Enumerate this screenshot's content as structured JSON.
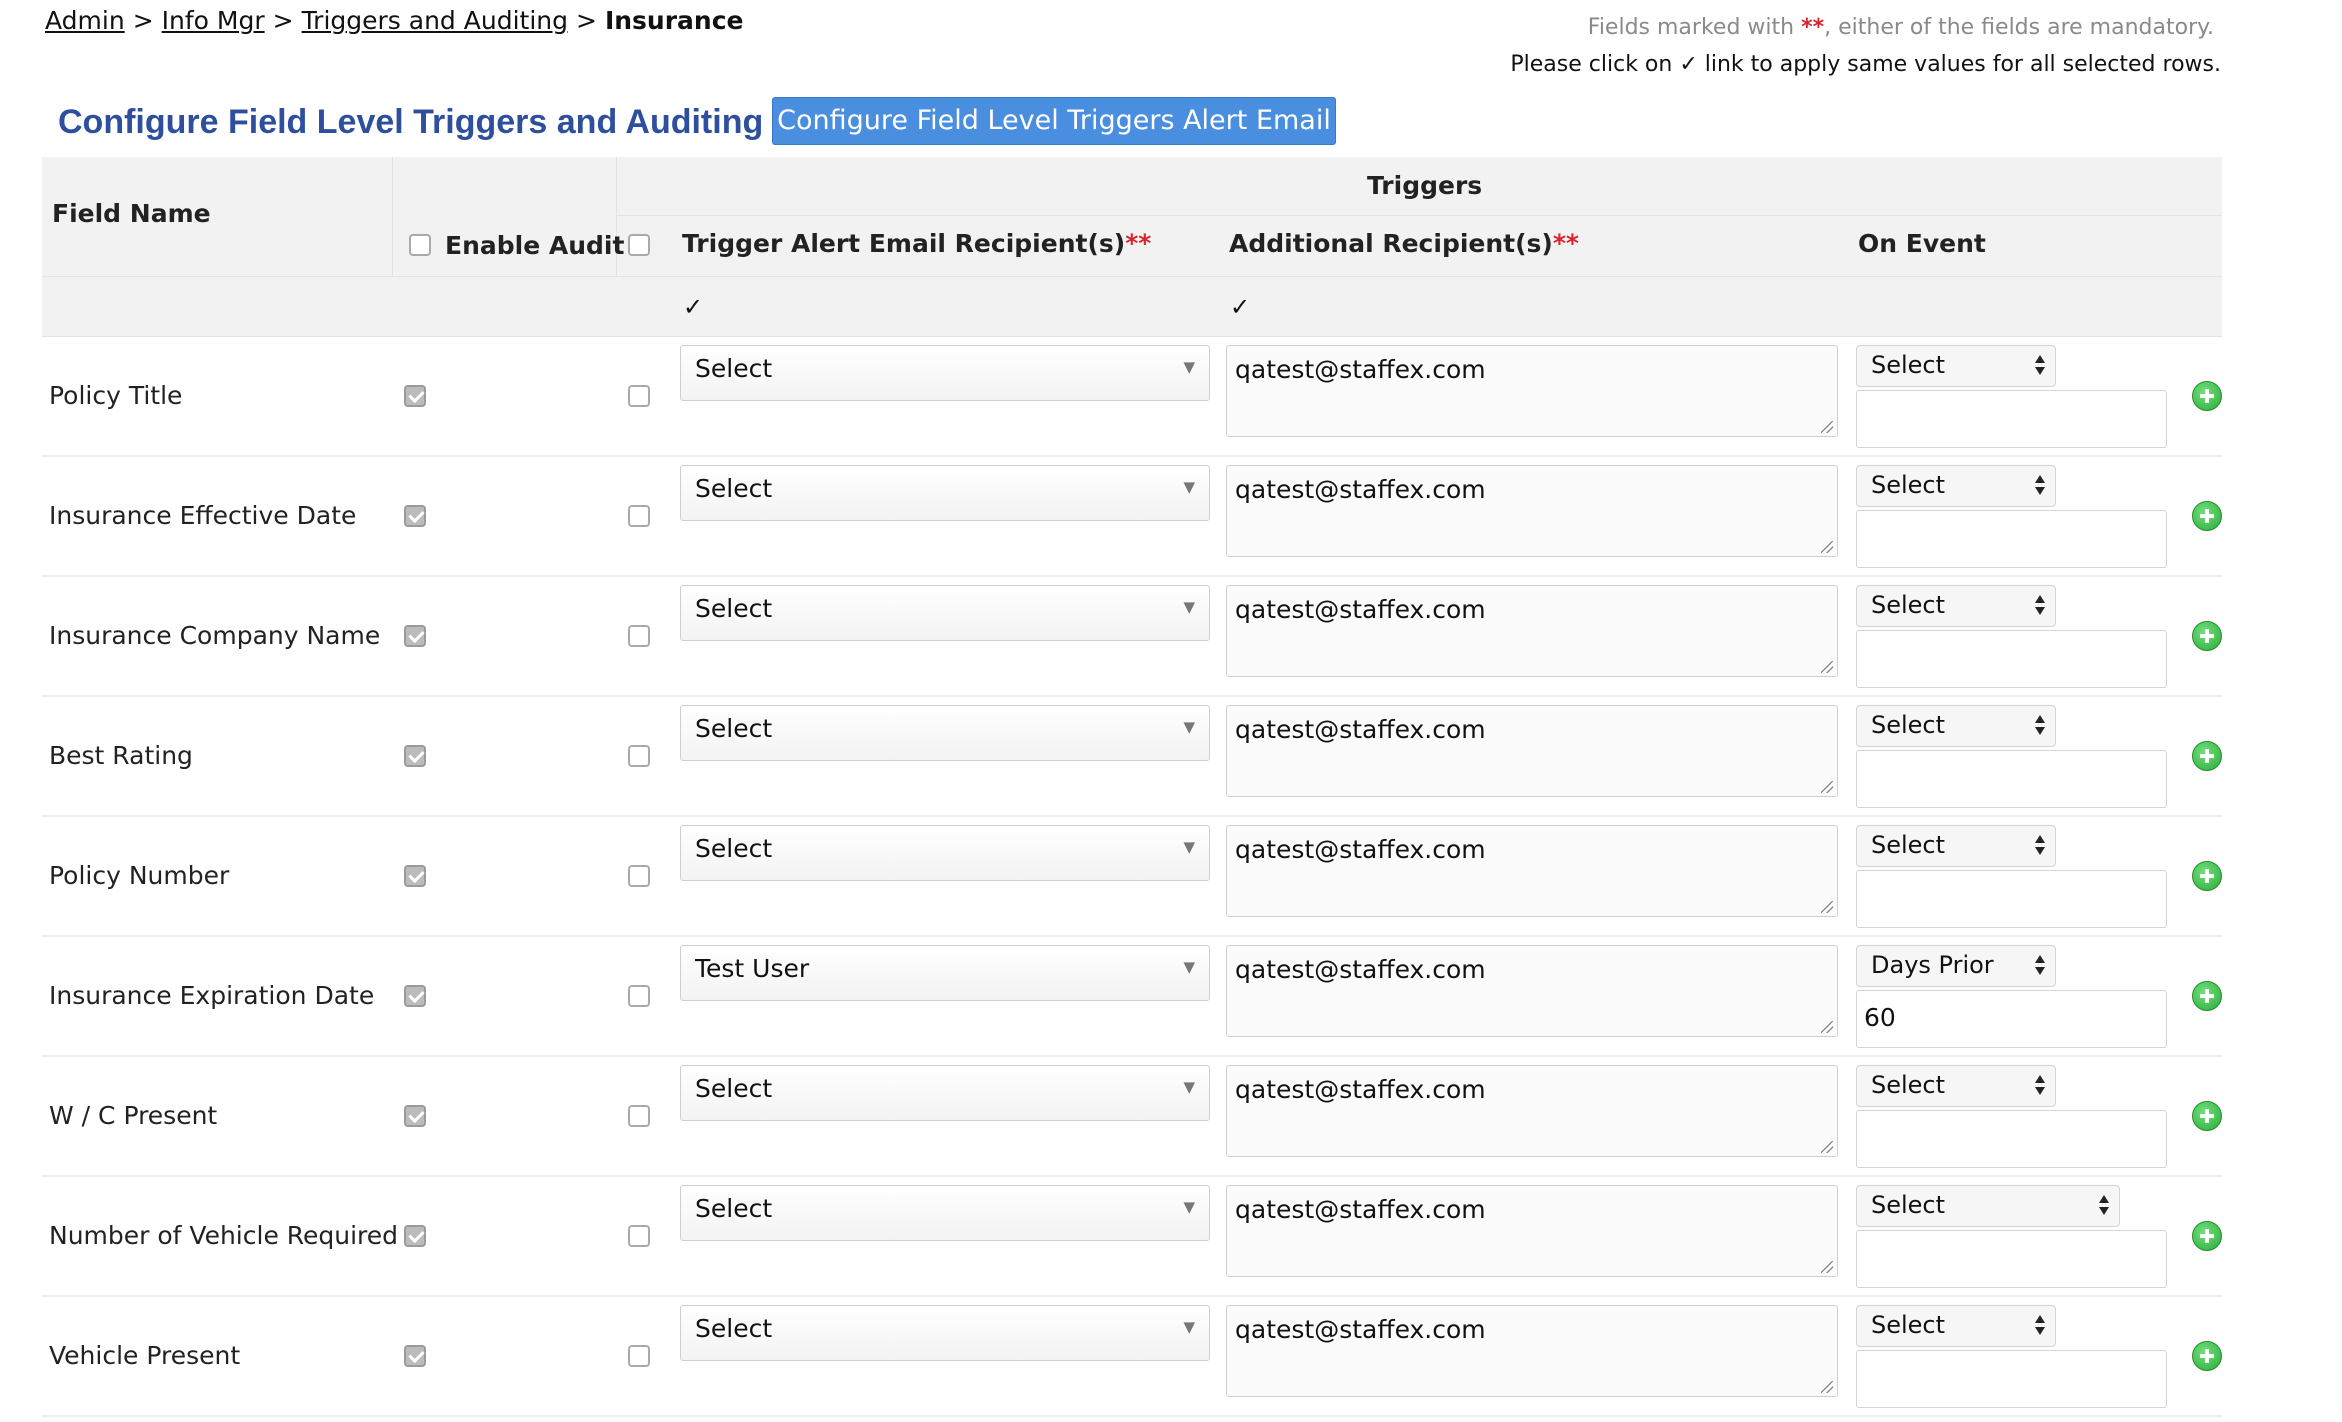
{
  "breadcrumb": {
    "items": [
      "Admin",
      "Info Mgr",
      "Triggers and Auditing"
    ],
    "separator": ">",
    "current": "Insurance"
  },
  "notes": {
    "mandatory_prefix": "Fields marked with",
    "mandatory_marker": "**",
    "mandatory_suffix": ", either of the fields are mandatory.",
    "apply_all": "Please click on ✓ link to apply same values for all selected rows."
  },
  "page_title": "Configure Field Level Triggers and Auditing",
  "alert_email_button": "Configure Field Level Triggers Alert Email",
  "table": {
    "headers": {
      "field_name": "Field Name",
      "enable_audit": "Enable Audit",
      "triggers": "Triggers",
      "trigger_recipients": "Trigger Alert Email Recipient(s)",
      "additional_recipients": "Additional Recipient(s)",
      "required_marker": "**",
      "on_event": "On Event",
      "apply_tick": "✓"
    },
    "rows": [
      {
        "field": "Policy Title",
        "audit": true,
        "trigger": false,
        "recipient": "Select",
        "emails": "qatest@staffex.com",
        "event": "Select",
        "days": ""
      },
      {
        "field": "Insurance Effective Date",
        "audit": true,
        "trigger": false,
        "recipient": "Select",
        "emails": "qatest@staffex.com",
        "event": "Select",
        "days": ""
      },
      {
        "field": "Insurance Company Name",
        "audit": true,
        "trigger": false,
        "recipient": "Select",
        "emails": "qatest@staffex.com",
        "event": "Select",
        "days": ""
      },
      {
        "field": "Best Rating",
        "audit": true,
        "trigger": false,
        "recipient": "Select",
        "emails": "qatest@staffex.com",
        "event": "Select",
        "days": ""
      },
      {
        "field": "Policy Number",
        "audit": true,
        "trigger": false,
        "recipient": "Select",
        "emails": "qatest@staffex.com",
        "event": "Select",
        "days": ""
      },
      {
        "field": "Insurance Expiration Date",
        "audit": true,
        "trigger": false,
        "recipient": "Test User",
        "emails": "qatest@staffex.com",
        "event": "Days Prior",
        "days": "60"
      },
      {
        "field": "W / C Present",
        "audit": true,
        "trigger": false,
        "recipient": "Select",
        "emails": "qatest@staffex.com",
        "event": "Select",
        "days": ""
      },
      {
        "field": "Number of Vehicle Required",
        "audit": true,
        "trigger": false,
        "recipient": "Select",
        "emails": "qatest@staffex.com",
        "event": "Select",
        "days": ""
      },
      {
        "field": "Vehicle Present",
        "audit": true,
        "trigger": false,
        "recipient": "Select",
        "emails": "qatest@staffex.com",
        "event": "Select",
        "days": ""
      }
    ]
  },
  "icons": {
    "dropdown": "caret-down-icon",
    "select_arrows": "up-down-arrows-icon",
    "add": "green-plus-circle-icon",
    "resize": "resize-grip-icon"
  },
  "colors": {
    "title": "#2d4f9e",
    "button": "#4a8ee0",
    "required": "#d9232e",
    "add": "#2eaa3a"
  }
}
